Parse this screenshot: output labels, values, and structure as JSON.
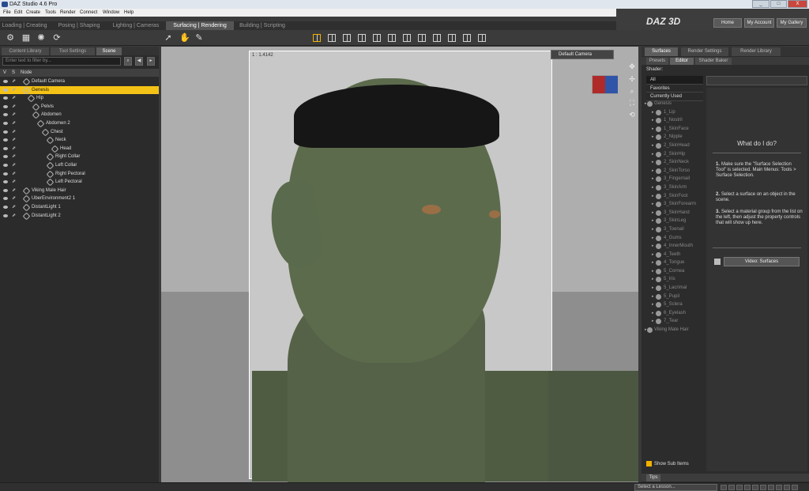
{
  "window": {
    "title": "DAZ Studio 4.6 Pro",
    "minimize": "_",
    "maximize": "□",
    "close": "X"
  },
  "menu": [
    "File",
    "Edit",
    "Create",
    "Tools",
    "Render",
    "Connect",
    "Window",
    "Help"
  ],
  "brand": {
    "logo": "DAZ 3D",
    "buttons": [
      "Home",
      "My Account",
      "My Gallery"
    ]
  },
  "workspace_tabs": [
    {
      "label": "Loading | Creating",
      "active": false
    },
    {
      "label": "Posing | Shaping",
      "active": false
    },
    {
      "label": "Lighting | Cameras",
      "active": false
    },
    {
      "label": "Surfacing | Rendering",
      "active": true
    },
    {
      "label": "Building | Scripting",
      "active": false
    }
  ],
  "left_panel": {
    "tabs": [
      {
        "label": "Content Library",
        "active": false
      },
      {
        "label": "Tool Settings",
        "active": false
      },
      {
        "label": "Scene",
        "active": true
      }
    ],
    "search_placeholder": "Enter text to filter by...",
    "header": {
      "v": "V",
      "s": "S",
      "node": "Node"
    },
    "nodes": [
      {
        "label": "Default Camera",
        "depth": 0,
        "selected": false
      },
      {
        "label": "Genesis",
        "depth": 0,
        "selected": true
      },
      {
        "label": "Hip",
        "depth": 1,
        "selected": false
      },
      {
        "label": "Pelvis",
        "depth": 2,
        "selected": false
      },
      {
        "label": "Abdomen",
        "depth": 2,
        "selected": false
      },
      {
        "label": "Abdomen 2",
        "depth": 3,
        "selected": false
      },
      {
        "label": "Chest",
        "depth": 4,
        "selected": false
      },
      {
        "label": "Neck",
        "depth": 5,
        "selected": false
      },
      {
        "label": "Head",
        "depth": 6,
        "selected": false
      },
      {
        "label": "Right Collar",
        "depth": 5,
        "selected": false
      },
      {
        "label": "Left Collar",
        "depth": 5,
        "selected": false
      },
      {
        "label": "Right Pectoral",
        "depth": 5,
        "selected": false
      },
      {
        "label": "Left Pectoral",
        "depth": 5,
        "selected": false
      },
      {
        "label": "Viking Male Hair",
        "depth": 0,
        "selected": false
      },
      {
        "label": "UberEnvironment2 1",
        "depth": 0,
        "selected": false
      },
      {
        "label": "DistantLight 1",
        "depth": 0,
        "selected": false
      },
      {
        "label": "DistantLight 2",
        "depth": 0,
        "selected": false
      }
    ]
  },
  "viewport": {
    "zoom_label": "1 : 1.4142",
    "camera": "Default Camera"
  },
  "right_panel": {
    "tabs": [
      {
        "label": "Surfaces",
        "active": true
      },
      {
        "label": "Render Settings",
        "active": false
      },
      {
        "label": "Render Library",
        "active": false
      }
    ],
    "subtabs": [
      {
        "label": "Presets",
        "active": false
      },
      {
        "label": "Editor",
        "active": true
      },
      {
        "label": "Shader Baker",
        "active": false
      }
    ],
    "shader_label": "Shader:",
    "filters": [
      {
        "label": "All",
        "selected": true
      },
      {
        "label": "Favorites",
        "selected": false
      },
      {
        "label": "Currently Used",
        "selected": false
      }
    ],
    "materials": [
      "Genesis",
      "1_Lip",
      "1_Nostril",
      "1_SkinFace",
      "2_Nipple",
      "2_SkinHead",
      "2_SkinHip",
      "2_SkinNeck",
      "2_SkinTorso",
      "3_Fingernail",
      "3_SkinArm",
      "3_SkinFoot",
      "3_SkinForearm",
      "3_SkinHand",
      "3_SkinLeg",
      "3_Toenail",
      "4_Gums",
      "4_InnerMouth",
      "4_Teeth",
      "4_Tongue",
      "5_Cornea",
      "5_Iris",
      "5_Lacrimal",
      "5_Pupil",
      "5_Sclera",
      "6_Eyelash",
      "7_Tear",
      "Viking Male Hair"
    ],
    "help": {
      "title": "What do I do?",
      "steps": [
        {
          "num": "1.",
          "text": "Make sure the \"Surface Selection Tool\" is selected. Main Menus: Tools > Surface Selection."
        },
        {
          "num": "2.",
          "text": "Select a surface on an object in the scene."
        },
        {
          "num": "3.",
          "text": "Select a material group from the list on the left, then adjust the property controls that will show up here."
        }
      ],
      "video_button": "Video: Surfaces"
    },
    "show_sub_items": "Show Sub Items",
    "tips_tab": "Tips"
  },
  "status": {
    "lesson": "Select a Lesson..."
  }
}
